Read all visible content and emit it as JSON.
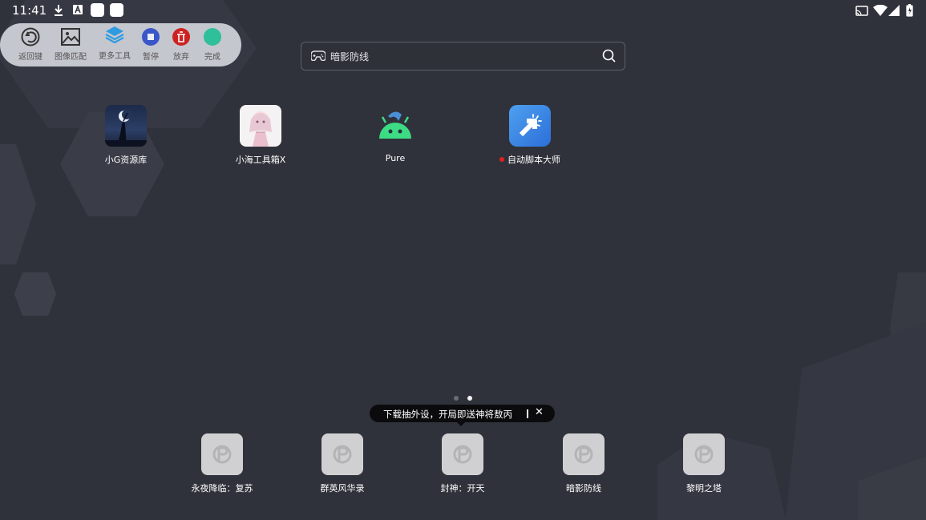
{
  "status_bar": {
    "time": "11:41",
    "left_icons": [
      "download-icon",
      "a-badge-icon",
      "app-notification-icon",
      "app-notification-icon"
    ],
    "right_icons": [
      "cast-icon",
      "wifi-icon",
      "signal-icon",
      "battery-charging-icon"
    ]
  },
  "toolbar": {
    "items": [
      {
        "label": "返回键",
        "icon": "back-key-icon"
      },
      {
        "label": "图像匹配",
        "icon": "image-match-icon"
      },
      {
        "label": "更多工具",
        "icon": "layers-icon"
      },
      {
        "label": "暂停",
        "icon": "pause-icon"
      },
      {
        "label": "放弃",
        "icon": "discard-icon"
      },
      {
        "label": "完成",
        "icon": "done-icon"
      }
    ]
  },
  "search": {
    "text": "暗影防线",
    "icon_left": "gamepad-icon",
    "icon_right": "search-icon"
  },
  "apps": [
    {
      "name": "小G资源库"
    },
    {
      "name": "小海工具箱X"
    },
    {
      "name": "Pure"
    },
    {
      "name": "自动脚本大师",
      "new_indicator": true
    }
  ],
  "pager": {
    "count": 2,
    "active": 2
  },
  "toast": {
    "text": "下载抽外设，开局即送神将敖丙",
    "close": "✕"
  },
  "dock": [
    {
      "name": "永夜降临：复苏"
    },
    {
      "name": "群英风华录"
    },
    {
      "name": "封神：开天"
    },
    {
      "name": "暗影防线"
    },
    {
      "name": "黎明之塔"
    }
  ],
  "colors": {
    "background": "#30323b",
    "toolbar": "#c5c7ce",
    "pause": "#3a56c9",
    "discard": "#cc2222",
    "done": "#2fbf9a",
    "android_green": "#3ddc84"
  }
}
